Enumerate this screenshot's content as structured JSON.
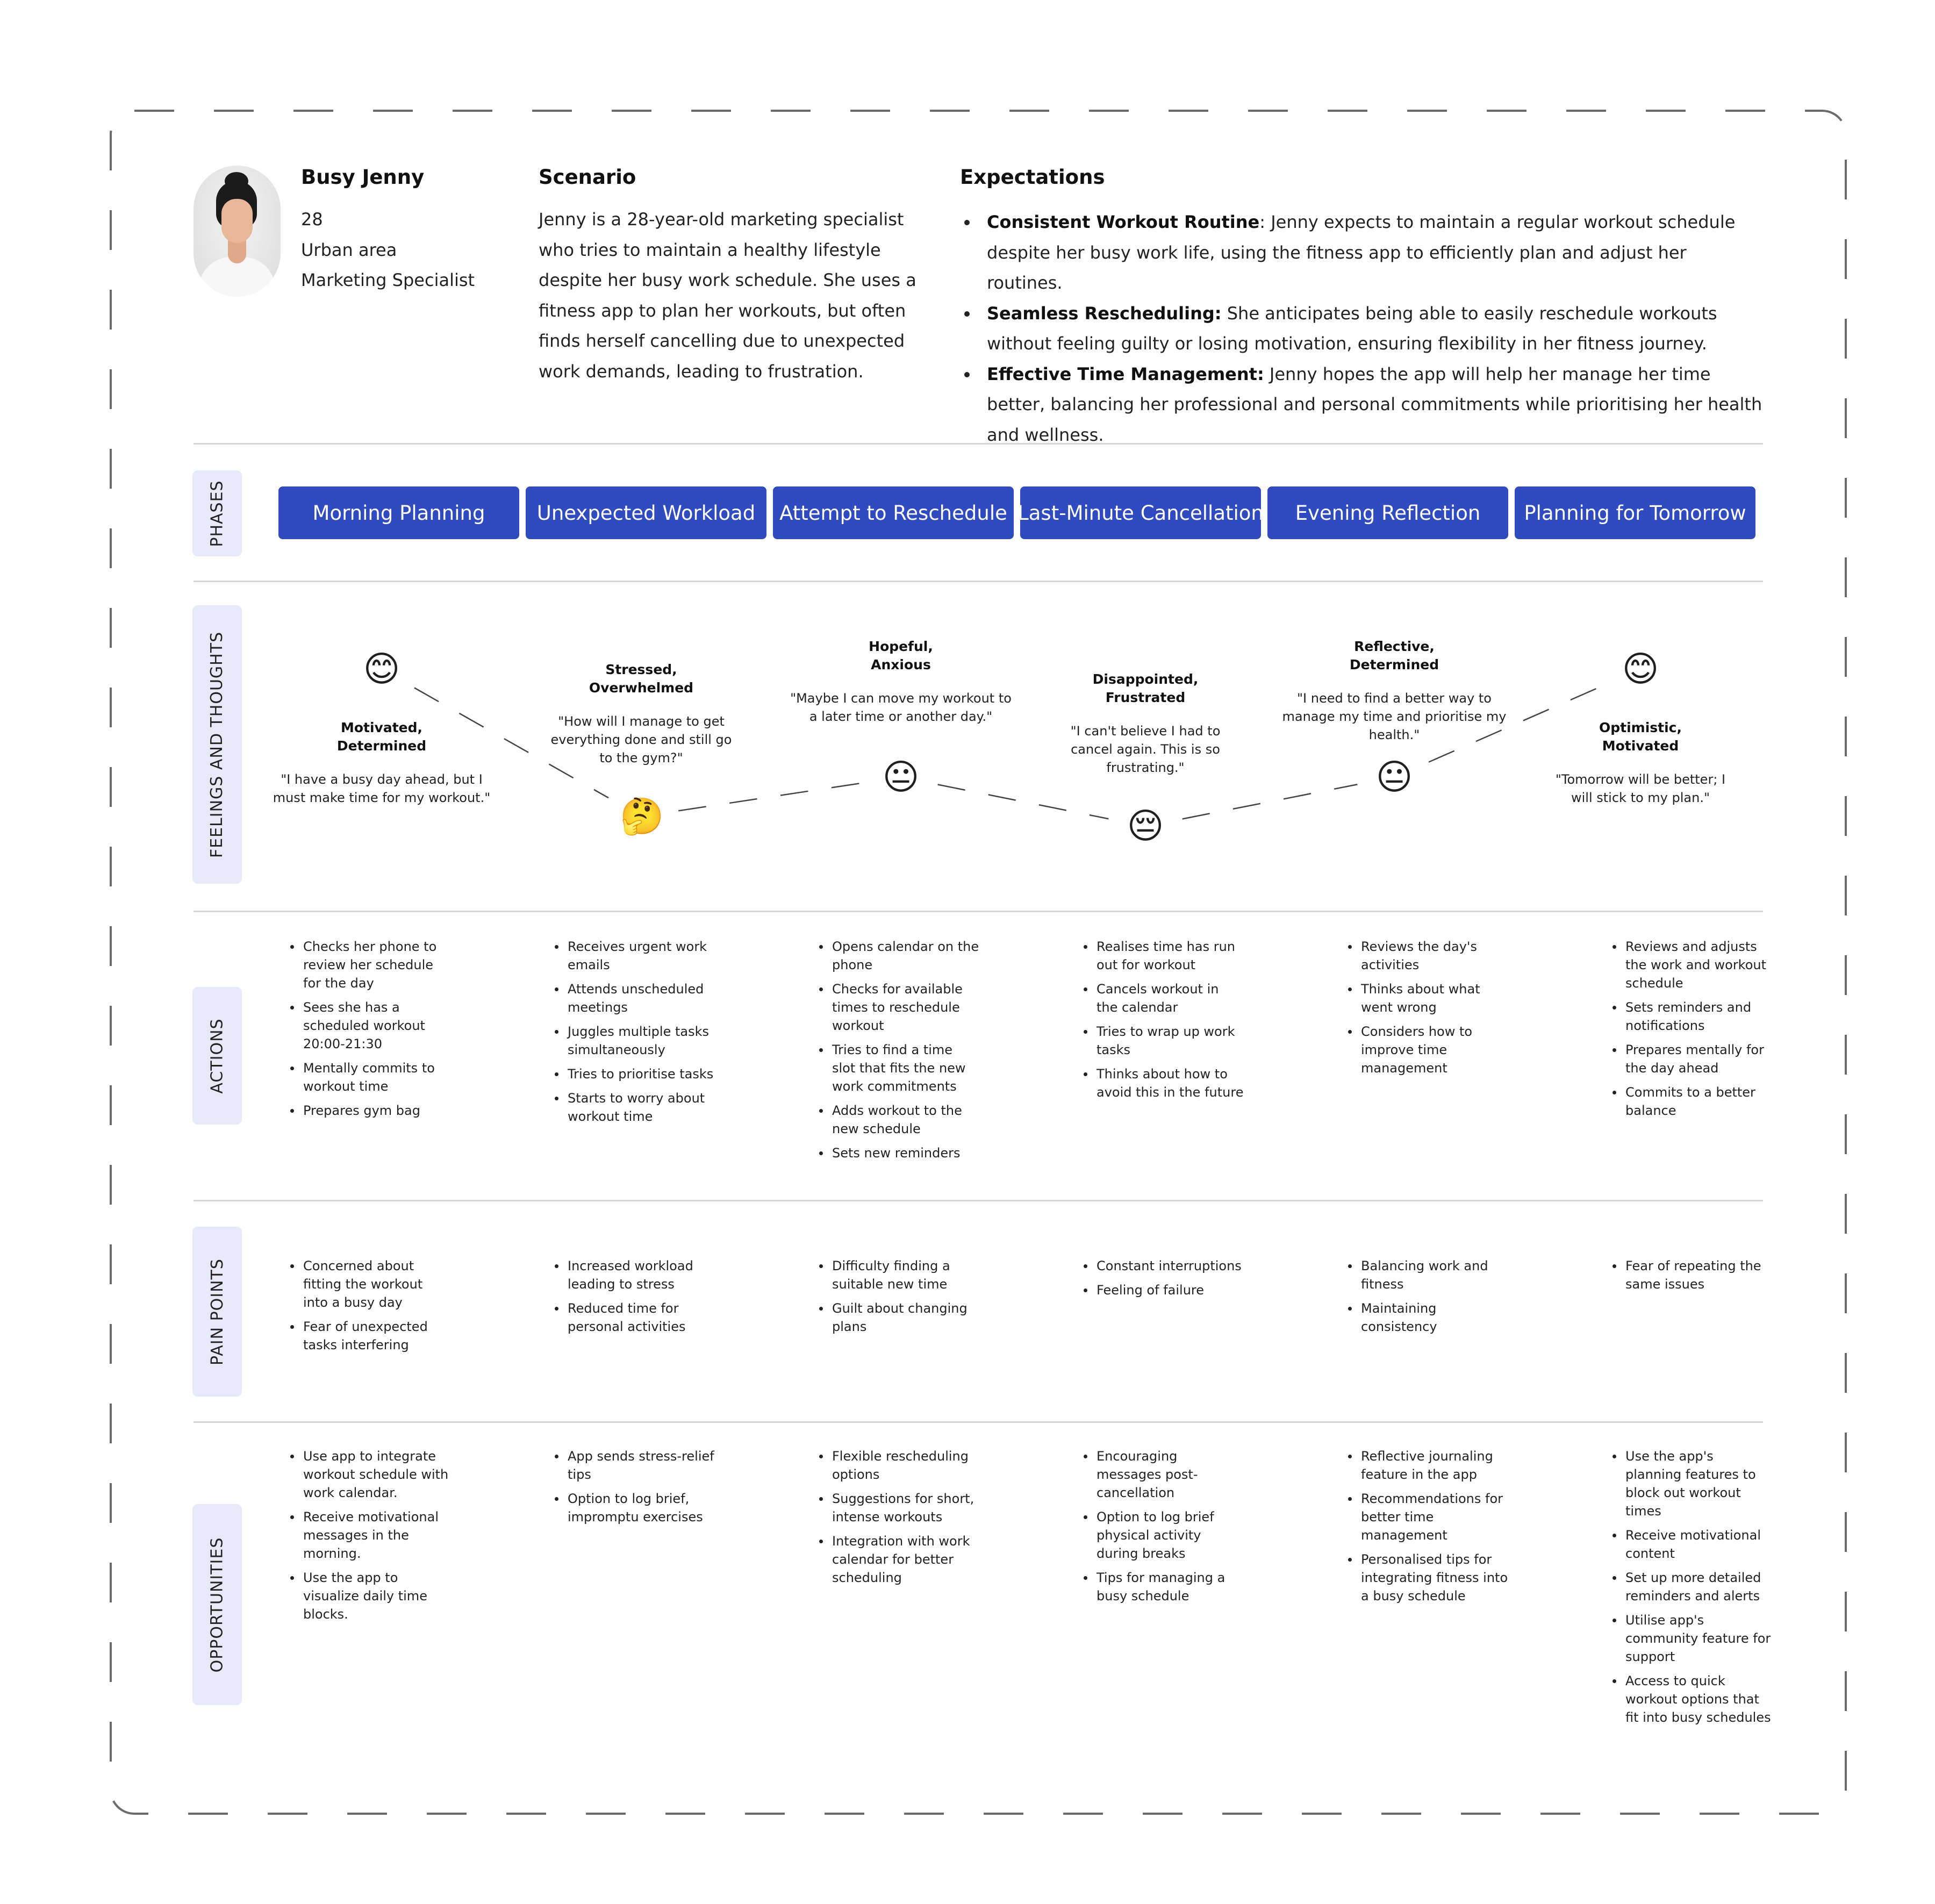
{
  "persona": {
    "name": "Busy Jenny",
    "age": "28",
    "location": "Urban area",
    "occupation": "Marketing Specialist",
    "avatar": "woman-portrait-photo"
  },
  "scenario": {
    "title": "Scenario",
    "lines": [
      "Jenny is a 28-year-old marketing specialist",
      "who tries to maintain a healthy lifestyle",
      "despite her busy work schedule. She uses a",
      "fitness app to plan her workouts, but often",
      "finds herself cancelling due to unexpected",
      "work demands, leading to frustration."
    ]
  },
  "expectations": {
    "title": "Expectations",
    "items": [
      {
        "bold": "Consistent Workout Routine",
        "text": ": Jenny expects to maintain a regular workout schedule despite her busy work life, using the fitness app to efficiently plan and adjust her routines."
      },
      {
        "bold": "Seamless Rescheduling:",
        "text": " She anticipates being able to easily reschedule workouts without feeling guilty or losing motivation, ensuring flexibility in her fitness journey."
      },
      {
        "bold": "Effective Time Management:",
        "text": " Jenny hopes the app will help her manage her time better, balancing her professional and personal commitments while prioritising her health and wellness."
      }
    ]
  },
  "rows": {
    "phases": "PHASES",
    "feelings": "FEELINGS AND THOUGHTS",
    "actions": "ACTIONS",
    "pain_points": "PAIN POINTS",
    "opportunities": "OPPORTUNITIES"
  },
  "colors": {
    "phase_bg": "#304abf",
    "chip_bg": "#e8e9f8",
    "divider": "#d6d6d6",
    "frame": "#6b6b6b"
  },
  "phases": [
    "Morning Planning",
    "Unexpected Workload",
    "Attempt to Reschedule",
    "Last-Minute Cancellation",
    "Evening Reflection",
    "Planning for Tomorrow"
  ],
  "feelings": [
    {
      "emoji": "😊",
      "emoji_name": "smiling-face-icon",
      "level": 0.9,
      "title1": "Motivated,",
      "title2": "Determined",
      "quote": "\"I have a busy day ahead, but I must make time for my workout.\"",
      "text_position": "below"
    },
    {
      "emoji": "🤔",
      "emoji_name": "thinking-face-icon",
      "level": 0.15,
      "title1": "Stressed,",
      "title2": "Overwhelmed",
      "quote": "\"How will I manage to get everything done and still go to the gym?\"",
      "text_position": "above"
    },
    {
      "emoji": "😐",
      "emoji_name": "neutral-face-icon",
      "level": 0.35,
      "title1": "Hopeful,",
      "title2": "Anxious",
      "quote": "\"Maybe I can move my workout to a later time or another day.\"",
      "text_position": "above"
    },
    {
      "emoji": "😔",
      "emoji_name": "pensive-face-icon",
      "level": 0.1,
      "title1": "Disappointed,",
      "title2": "Frustrated",
      "quote": "\"I can't believe I had to cancel again. This is so frustrating.\"",
      "text_position": "above"
    },
    {
      "emoji": "😐",
      "emoji_name": "neutral-face-icon",
      "level": 0.35,
      "title1": "Reflective,",
      "title2": "Determined",
      "quote": "\"I need to find a better way to manage my time and prioritise my health.\"",
      "text_position": "above"
    },
    {
      "emoji": "😊",
      "emoji_name": "smiling-face-icon",
      "level": 0.9,
      "title1": "Optimistic,",
      "title2": "Motivated",
      "quote": "\"Tomorrow will be better; I will stick to my plan.\"",
      "text_position": "below"
    }
  ],
  "actions": [
    [
      "Checks her phone to review her schedule for the day",
      "Sees she has a scheduled workout 20:00-21:30",
      "Mentally commits to workout time",
      "Prepares gym bag"
    ],
    [
      "Receives urgent work emails",
      "Attends unscheduled meetings",
      "Juggles multiple tasks simultaneously",
      "Tries to prioritise tasks",
      "Starts to worry about workout time"
    ],
    [
      "Opens calendar on the phone",
      "Checks for available times to reschedule workout",
      "Tries to find a time slot that fits the new work commitments",
      "Adds workout to the new schedule",
      "Sets new reminders"
    ],
    [
      "Realises time has run out for workout",
      "Cancels workout in the calendar",
      "Tries to wrap up work tasks",
      "Thinks about how to avoid this in the future"
    ],
    [
      "Reviews the day's activities",
      "Thinks about what went wrong",
      "Considers how to improve time management"
    ],
    [
      "Reviews and adjusts the work and workout schedule",
      "Sets reminders and notifications",
      "Prepares mentally for the day ahead",
      "Commits to a better balance"
    ]
  ],
  "pain_points": [
    [
      "Concerned about fitting the workout into a busy day",
      "Fear of unexpected tasks interfering"
    ],
    [
      "Increased workload leading to stress",
      "Reduced time for personal activities"
    ],
    [
      "Difficulty finding a suitable new time",
      "Guilt about changing plans"
    ],
    [
      "Constant interruptions",
      "Feeling of failure"
    ],
    [
      "Balancing work and fitness",
      "Maintaining consistency"
    ],
    [
      "Fear of repeating the same issues"
    ]
  ],
  "opportunities": [
    [
      "Use app to integrate workout schedule with work calendar.",
      "Receive motivational messages in the morning.",
      "Use the app to visualize daily time blocks."
    ],
    [
      "App sends stress-relief tips",
      "Option to log brief, impromptu exercises"
    ],
    [
      "Flexible rescheduling options",
      "Suggestions for short, intense workouts",
      "Integration with work calendar for better scheduling"
    ],
    [
      "Encouraging messages post-cancellation",
      "Option to log brief physical activity during breaks",
      "Tips for managing a busy schedule"
    ],
    [
      "Reflective journaling feature in the app",
      "Recommendations for better time management",
      "Personalised tips for integrating fitness into a busy schedule"
    ],
    [
      "Use the app's planning features to block out workout times",
      "Receive motivational content",
      "Set up more detailed reminders and alerts",
      "Utilise app's community feature for support",
      "Access to quick workout options that fit into busy schedules"
    ]
  ]
}
